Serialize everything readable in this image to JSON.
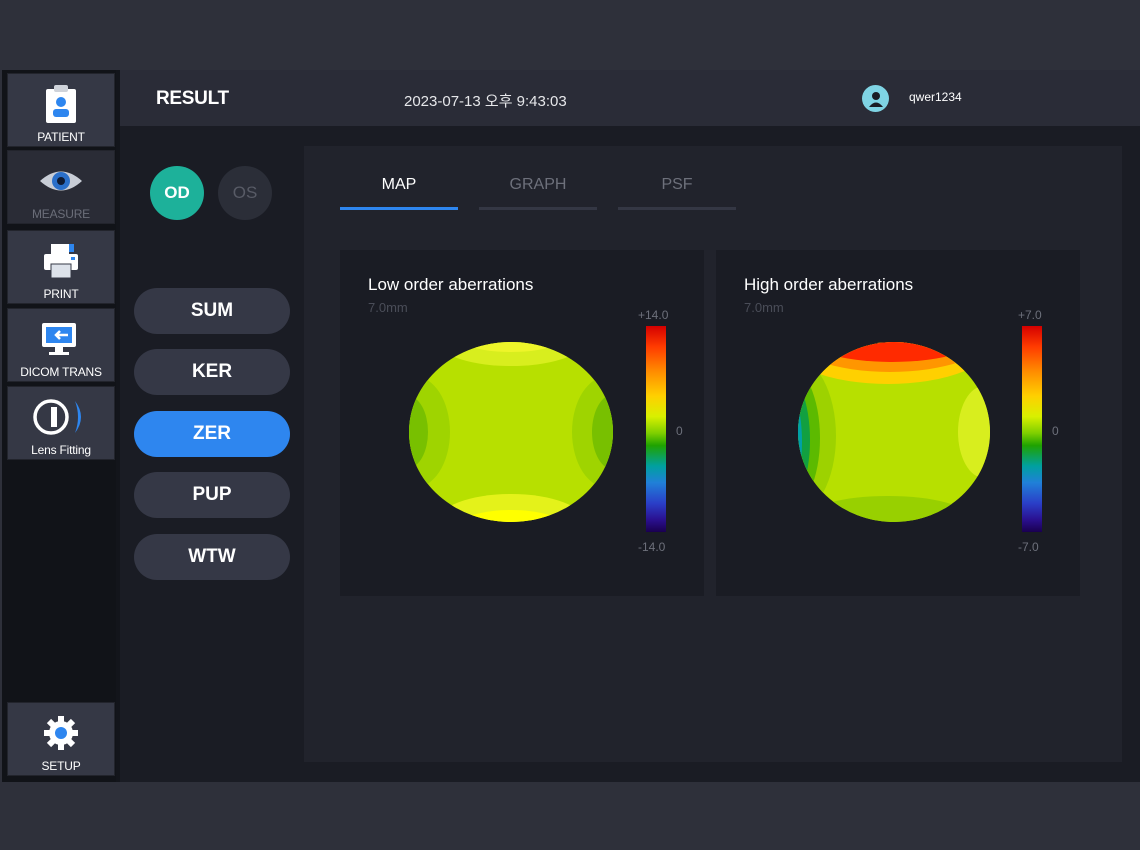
{
  "sidebar": {
    "items": [
      {
        "label": "PATIENT",
        "icon": "clipboard-patient-icon",
        "enabled": true
      },
      {
        "label": "MEASURE",
        "icon": "eye-icon",
        "enabled": false
      },
      {
        "label": "PRINT",
        "icon": "printer-icon",
        "enabled": true
      },
      {
        "label": "DICOM TRANS",
        "icon": "monitor-transfer-icon",
        "enabled": true
      },
      {
        "label": "Lens Fitting",
        "icon": "lens-icon",
        "enabled": true
      }
    ],
    "setup_label": "SETUP"
  },
  "header": {
    "title": "RESULT",
    "datetime": "2023-07-13 오후 9:43:03",
    "username": "qwer1234"
  },
  "eye_select": {
    "od": "OD",
    "os": "OS",
    "selected": "OD"
  },
  "modes": [
    {
      "label": "SUM",
      "active": false
    },
    {
      "label": "KER",
      "active": false
    },
    {
      "label": "ZER",
      "active": true
    },
    {
      "label": "PUP",
      "active": false
    },
    {
      "label": "WTW",
      "active": false
    }
  ],
  "tabs": [
    {
      "label": "MAP",
      "active": true
    },
    {
      "label": "GRAPH",
      "active": false
    },
    {
      "label": "PSF",
      "active": false
    }
  ],
  "maps": [
    {
      "title": "Low order aberrations",
      "pupil": "7.0mm",
      "scale_max": "+14.0",
      "scale_mid": "0",
      "scale_min": "-14.0"
    },
    {
      "title": "High order aberrations",
      "pupil": "7.0mm",
      "scale_max": "+7.0",
      "scale_mid": "0",
      "scale_min": "-7.0"
    }
  ],
  "colors": {
    "accent_blue": "#2e86ef",
    "od_teal": "#1db19a",
    "avatar": "#7fd4e4",
    "background": "#1a1c24"
  }
}
